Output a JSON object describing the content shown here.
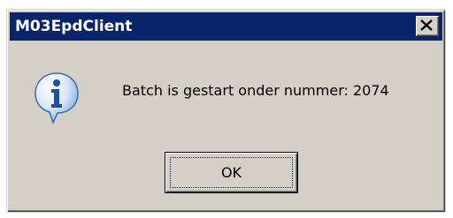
{
  "window": {
    "title": "M03EpdClient",
    "close_icon": "close-icon"
  },
  "content": {
    "icon": "information-icon",
    "message": "Batch is gestart onder nummer: 2074"
  },
  "buttons": {
    "ok_label": "OK"
  },
  "colors": {
    "titlebar": "#0a246a",
    "dialog_face": "#d4d0c8",
    "title_text": "#ffffff"
  }
}
